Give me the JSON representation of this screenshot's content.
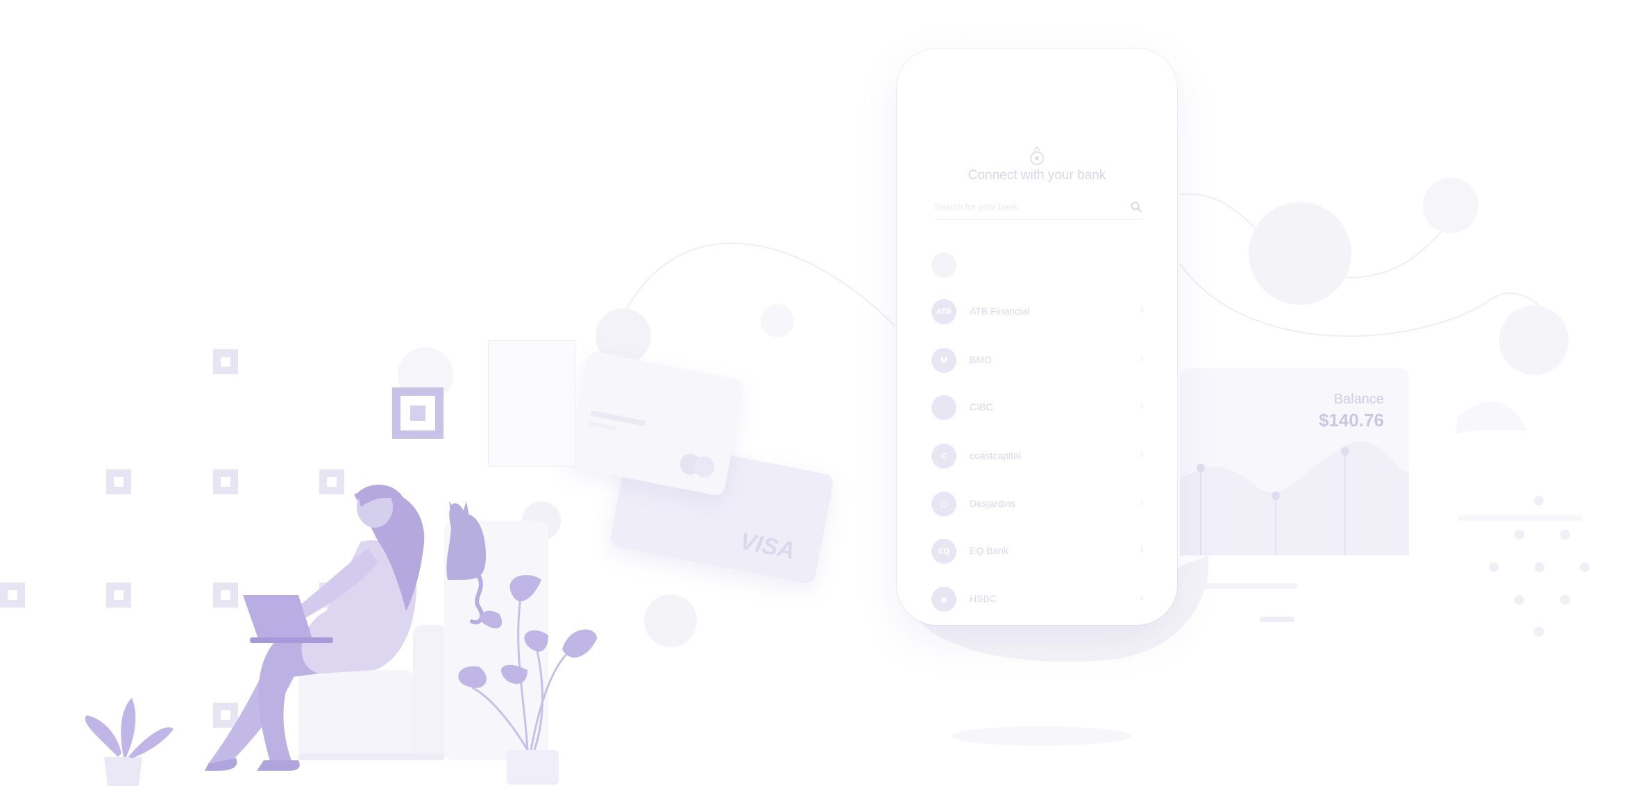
{
  "phone": {
    "title": "Connect with your bank",
    "search_placeholder": "Search for your bank",
    "banks": [
      {
        "logo_text": "",
        "name": "",
        "faded": true
      },
      {
        "logo_text": "ATB",
        "name": "ATB Financial",
        "faded": false
      },
      {
        "logo_text": "M",
        "name": "BMO",
        "faded": false
      },
      {
        "logo_text": "",
        "name": "CIBC",
        "faded": false
      },
      {
        "logo_text": "C",
        "name": "coastcapital",
        "faded": false
      },
      {
        "logo_text": "⬡",
        "name": "Desjardins",
        "faded": false
      },
      {
        "logo_text": "EQ",
        "name": "EQ Bank",
        "faded": false
      },
      {
        "logo_text": "◈",
        "name": "HSBC",
        "faded": false
      }
    ],
    "chevron": "›"
  },
  "balance": {
    "label": "Balance",
    "value": "$140.76"
  },
  "card": {
    "brand": "VISA"
  },
  "colors": {
    "accent": "#b7aee0",
    "accent_dark": "#a79ad9",
    "pale": "#efedf7"
  }
}
